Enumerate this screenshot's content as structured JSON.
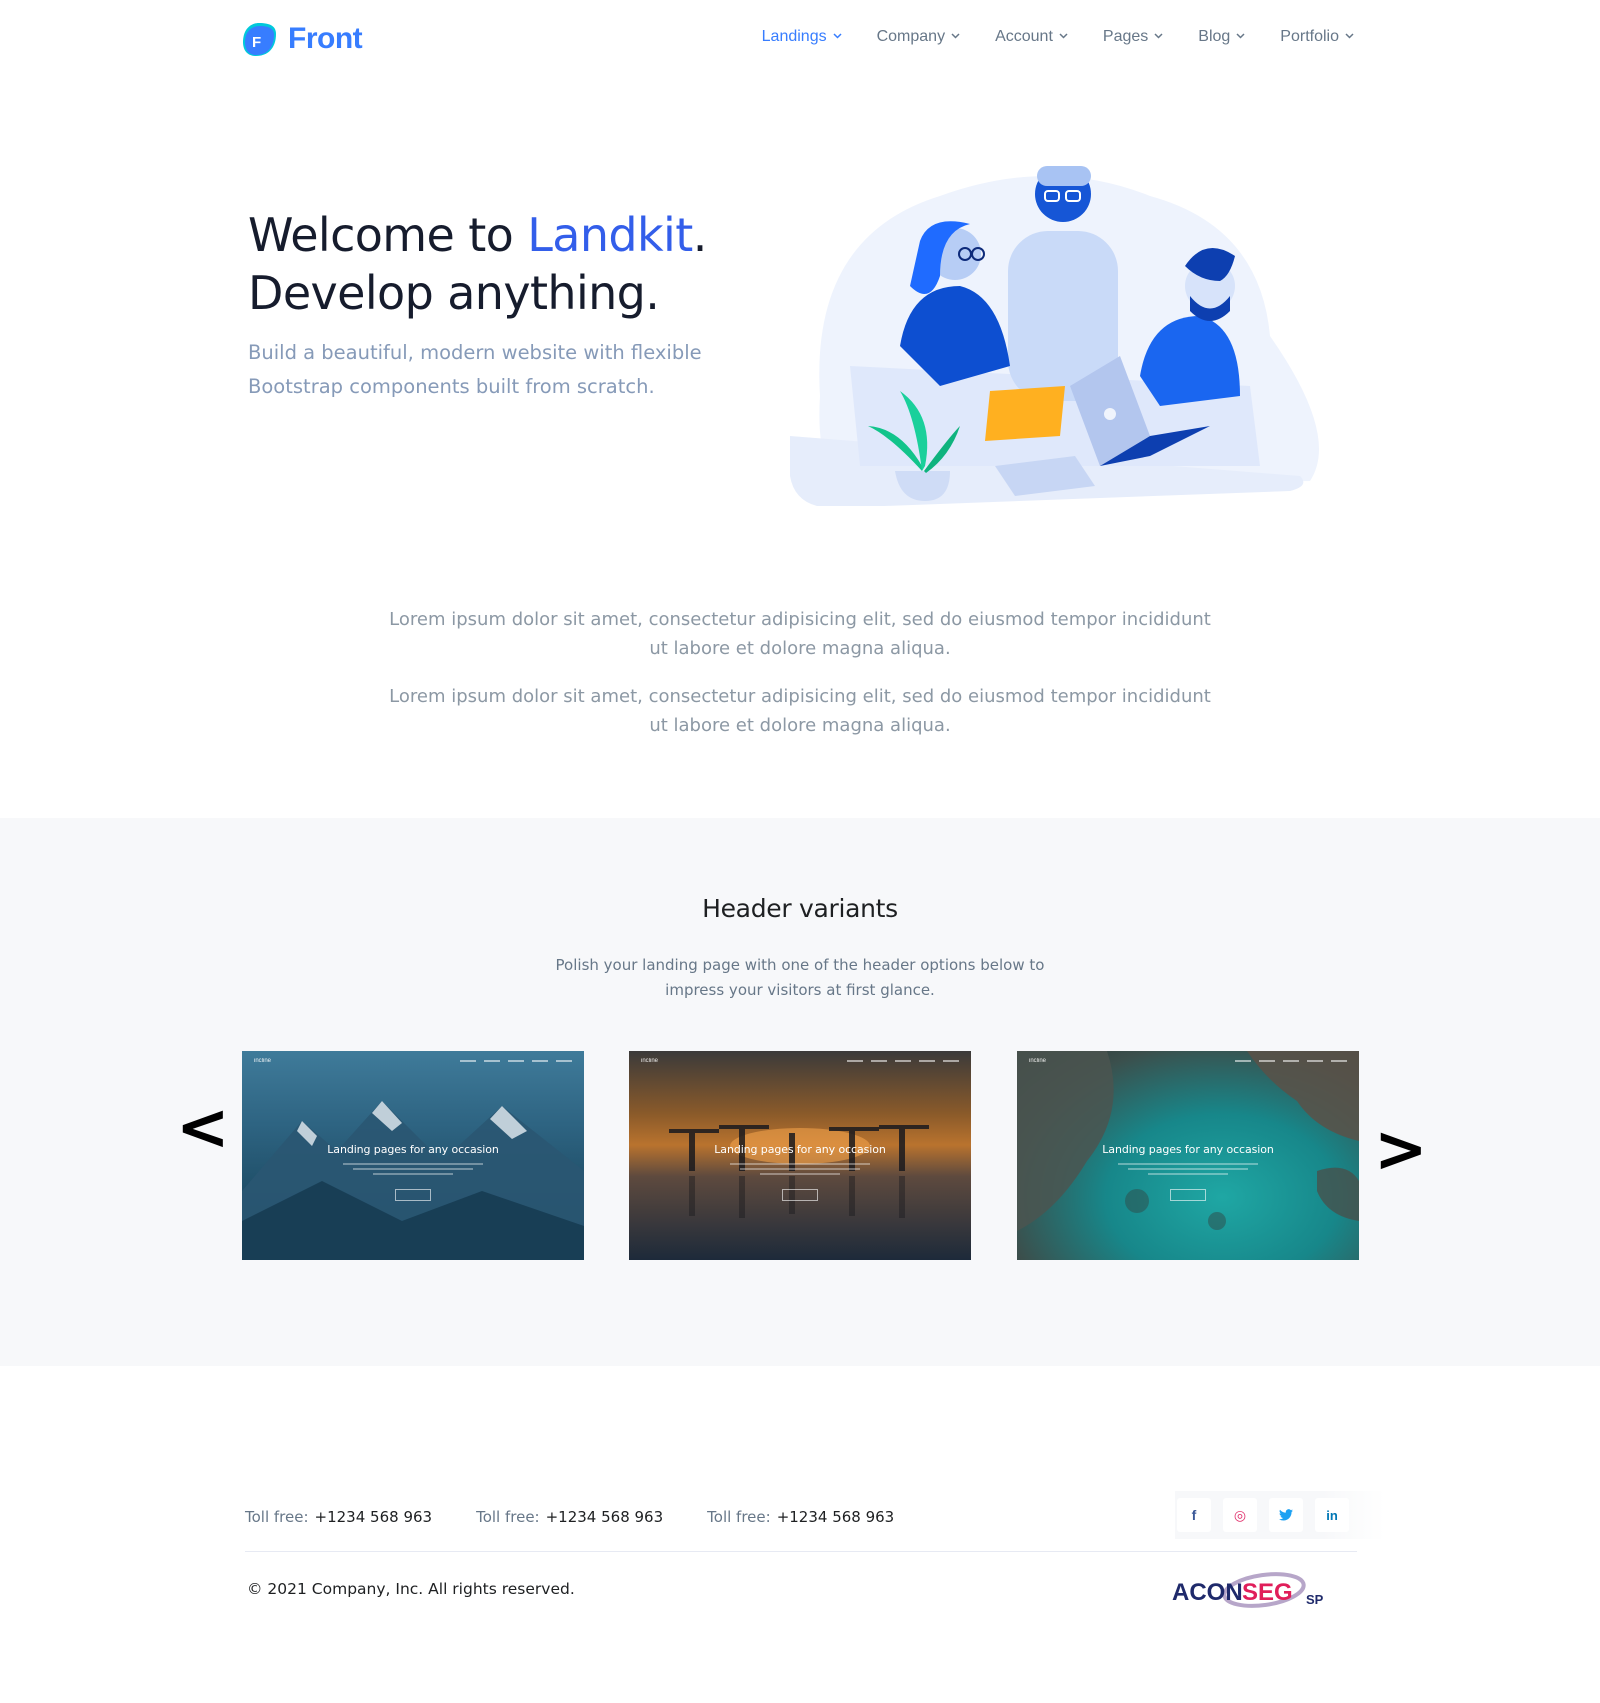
{
  "brand": {
    "name": "Front",
    "mark_letter": "F",
    "color": "#377dff"
  },
  "nav": {
    "items": [
      {
        "label": "Landings",
        "active": true
      },
      {
        "label": "Company",
        "active": false
      },
      {
        "label": "Account",
        "active": false
      },
      {
        "label": "Pages",
        "active": false
      },
      {
        "label": "Blog",
        "active": false
      },
      {
        "label": "Portfolio",
        "active": false
      }
    ],
    "chevron_icon": "chevron-down-icon"
  },
  "hero": {
    "title_prefix": "Welcome to ",
    "title_accent": "Landkit",
    "title_suffix": ".",
    "title_line2": "Develop anything.",
    "lead": "Build a beautiful, modern website with flexible Bootstrap components built from scratch.",
    "accent_color": "#335eea"
  },
  "intro": {
    "paragraphs": [
      "Lorem ipsum dolor sit amet, consectetur adipisicing elit, sed do eiusmod tempor incididunt ut labore et dolore magna aliqua.",
      "Lorem ipsum dolor sit amet, consectetur adipisicing elit, sed do eiusmod tempor incididunt ut labore et dolore magna aliqua."
    ]
  },
  "variants": {
    "title": "Header variants",
    "subtitle": "Polish your landing page with one of the header options below to impress your visitors at first glance.",
    "prev_icon": "chevron-left-icon",
    "next_icon": "chevron-right-icon",
    "cards": [
      {
        "title": "Landing pages for any occasion",
        "logo": "incline",
        "theme": "mountains"
      },
      {
        "title": "Landing pages for any occasion",
        "logo": "incline",
        "theme": "sunset"
      },
      {
        "title": "Landing pages for any occasion",
        "logo": "incline",
        "theme": "coast"
      }
    ]
  },
  "footer": {
    "tolls": [
      {
        "label": "Toll free:",
        "number": "+1234 568 963"
      },
      {
        "label": "Toll free:",
        "number": "+1234 568 963"
      },
      {
        "label": "Toll free:",
        "number": "+1234 568 963"
      }
    ],
    "socials": [
      {
        "icon": "facebook-icon",
        "glyph": "f",
        "color": "#3b5998"
      },
      {
        "icon": "instagram-icon",
        "glyph": "◎",
        "color": "#e1306c"
      },
      {
        "icon": "twitter-icon",
        "glyph": "🐦",
        "color": "#1da1f2"
      },
      {
        "icon": "linkedin-icon",
        "glyph": "in",
        "color": "#0077b5"
      }
    ],
    "copyright": "© 2021 Company, Inc. All rights reserved.",
    "partner_logo": {
      "text_a": "ACON",
      "text_b": "SEG",
      "suffix": "SP",
      "color_a": "#1f2a6b",
      "color_b": "#e01e5a"
    }
  }
}
